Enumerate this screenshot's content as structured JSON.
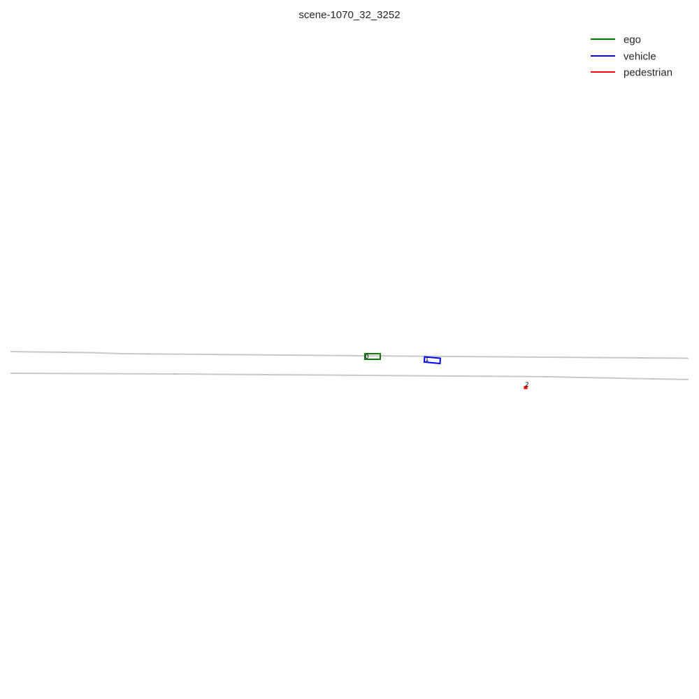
{
  "title": "scene-1070_32_3252",
  "legend": {
    "items": [
      {
        "key": "ego",
        "label": "ego",
        "color": "#008000"
      },
      {
        "key": "vehicle",
        "label": "vehicle",
        "color": "#0000ff"
      },
      {
        "key": "pedestrian",
        "label": "pedestrian",
        "color": "#ff0000"
      }
    ]
  },
  "agents": [
    {
      "id": "0",
      "type": "ego",
      "color": "#008000"
    },
    {
      "id": "1",
      "type": "vehicle",
      "color": "#0000ff"
    },
    {
      "id": "2",
      "type": "pedestrian",
      "color": "#ff0000"
    }
  ],
  "road": {
    "lane_color": "#c8c8c8"
  }
}
